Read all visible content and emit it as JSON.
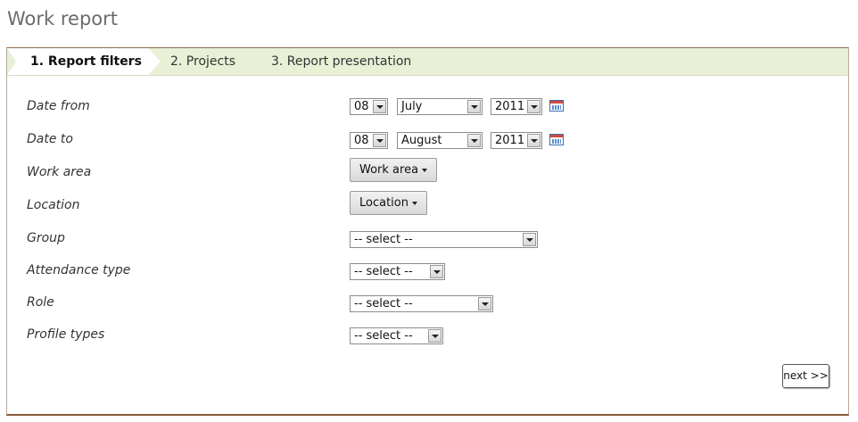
{
  "page": {
    "title": "Work report"
  },
  "tabs": [
    {
      "label": "1. Report filters"
    },
    {
      "label": "2. Projects"
    },
    {
      "label": "3. Report presentation"
    }
  ],
  "filters": {
    "date_from": {
      "label": "Date from",
      "day": "08",
      "month": "July",
      "year": "2011"
    },
    "date_to": {
      "label": "Date to",
      "day": "08",
      "month": "August",
      "year": "2011"
    },
    "work_area": {
      "label": "Work area",
      "button": "Work area"
    },
    "location": {
      "label": "Location",
      "button": "Location"
    },
    "group": {
      "label": "Group",
      "value": "-- select --"
    },
    "attendance_type": {
      "label": "Attendance type",
      "value": "-- select --"
    },
    "role": {
      "label": "Role",
      "value": "-- select --"
    },
    "profile_types": {
      "label": "Profile types",
      "value": "-- select --"
    }
  },
  "actions": {
    "next_label": "next >>"
  },
  "icons": {
    "calendar": "calendar-icon",
    "dropdown": "chevron-down-icon"
  },
  "colors": {
    "tab_bar": "#e8f0d6",
    "panel_border": "#8a5a3a",
    "title": "#6b6b6b"
  }
}
